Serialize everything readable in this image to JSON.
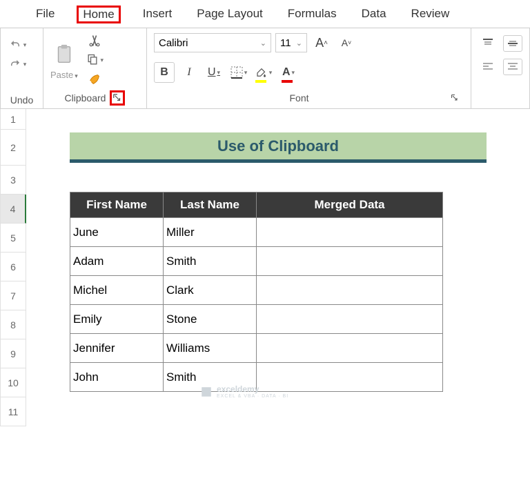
{
  "tabs": {
    "file": "File",
    "home": "Home",
    "insert": "Insert",
    "page_layout": "Page Layout",
    "formulas": "Formulas",
    "data": "Data",
    "review": "Review"
  },
  "ribbon": {
    "undo_group": "Undo",
    "clipboard_group": "Clipboard",
    "paste_label": "Paste",
    "font_group": "Font",
    "font_name": "Calibri",
    "font_size": "11"
  },
  "sheet": {
    "title": "Use of Clipboard",
    "headers": {
      "first": "First Name",
      "last": "Last Name",
      "merged": "Merged Data"
    },
    "rows": [
      {
        "first": "June",
        "last": "Miller",
        "merged": ""
      },
      {
        "first": "Adam",
        "last": "Smith",
        "merged": ""
      },
      {
        "first": "Michel",
        "last": "Clark",
        "merged": ""
      },
      {
        "first": "Emily",
        "last": "Stone",
        "merged": ""
      },
      {
        "first": "Jennifer",
        "last": "Williams",
        "merged": ""
      },
      {
        "first": "John",
        "last": "Smith",
        "merged": ""
      }
    ],
    "row_nums": [
      "1",
      "2",
      "3",
      "4",
      "5",
      "6",
      "7",
      "8",
      "9",
      "10",
      "11"
    ]
  },
  "watermark": {
    "brand": "exceldemy",
    "tagline": "EXCEL & VBA · DATA · BI"
  }
}
